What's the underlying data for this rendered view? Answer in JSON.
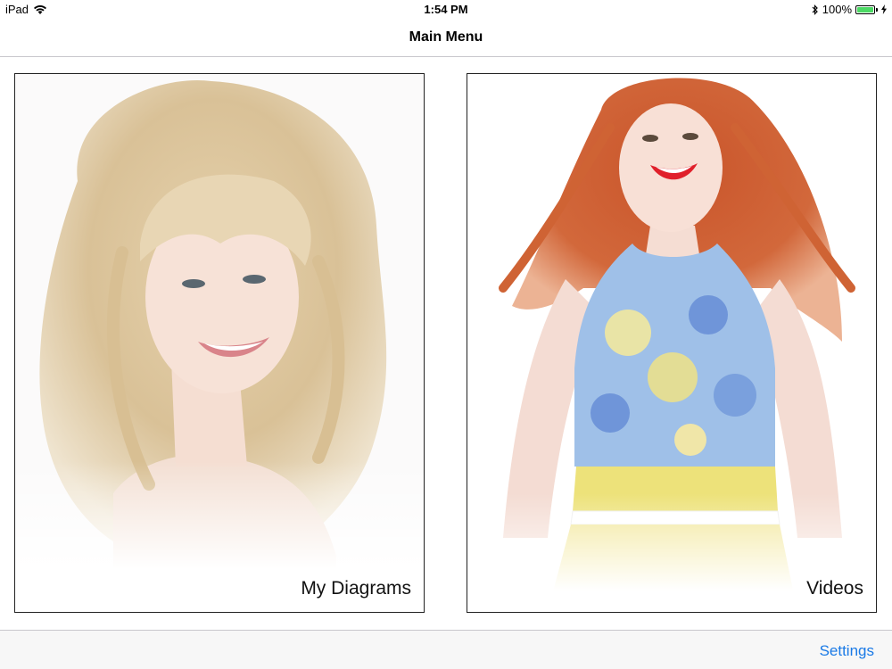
{
  "status_bar": {
    "device": "iPad",
    "time": "1:54 PM",
    "battery_percent": "100%",
    "battery_level": 1.0,
    "battery_color": "#4cd964"
  },
  "nav": {
    "title": "Main Menu"
  },
  "tiles": [
    {
      "label": "My Diagrams",
      "image": "blonde-woman-photo"
    },
    {
      "label": "Videos",
      "image": "redhead-woman-photo"
    }
  ],
  "toolbar": {
    "settings_label": "Settings",
    "accent_color": "#1a7ae6"
  }
}
